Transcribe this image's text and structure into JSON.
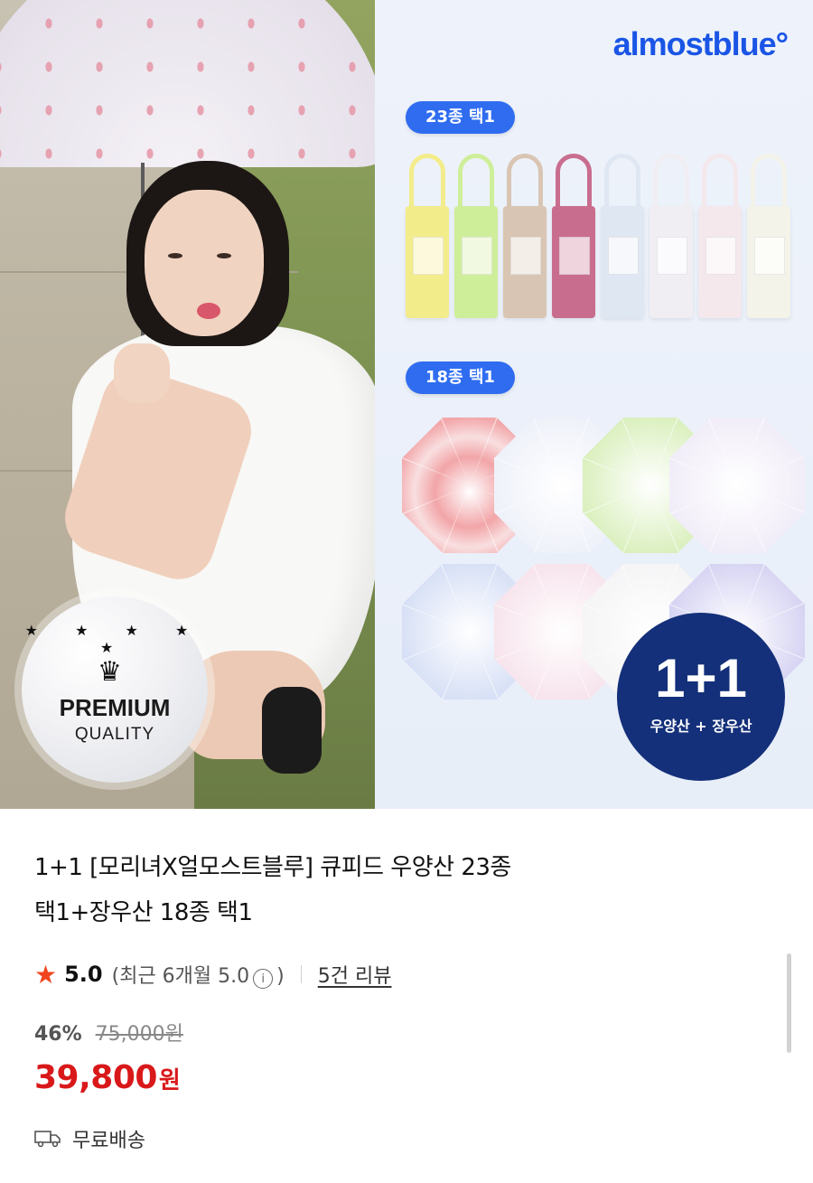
{
  "banner": {
    "brand": "almostblue°",
    "group1_label": "23종 택1",
    "group2_label": "18종 택1",
    "badge_title": "PREMIUM",
    "badge_sub": "QUALITY",
    "badge_stars": "★ ★ ★ ★ ★",
    "badge_crown": "♛",
    "promo_big": "1+1",
    "promo_small": "우양산 + 장우산",
    "mini_colors": [
      "#f3ec8a",
      "#cfee9a",
      "#d9c5b3",
      "#c96d8e",
      "#dfe7f3",
      "#f1eef3",
      "#f4e8ec",
      "#f3f3ea"
    ],
    "umbrella_colors": [
      "#f2a5a8",
      "#e9ecf8",
      "#cdeaa6",
      "#ece6f6",
      "#c8d4f2",
      "#f4d9e5",
      "#f1f1f3",
      "#c7c4ee"
    ]
  },
  "product": {
    "title_line1": "1+1 [모리녀X얼모스트블루] 큐피드 우양산 23종",
    "title_line2": "택1+장우산 18종 택1",
    "rating": "5.0",
    "recent_prefix": "(최근 6개월 5.0",
    "recent_suffix": ")",
    "info_icon": "i",
    "review_link": "5건 리뷰",
    "discount": "46%",
    "original_price": "75,000원",
    "price": "39,800",
    "currency": "원",
    "shipping": "무료배송"
  },
  "colors": {
    "accent_blue": "#2f6cf0",
    "price_red": "#d9181a",
    "star_orange": "#f0451e",
    "promo_navy": "#14307a"
  }
}
